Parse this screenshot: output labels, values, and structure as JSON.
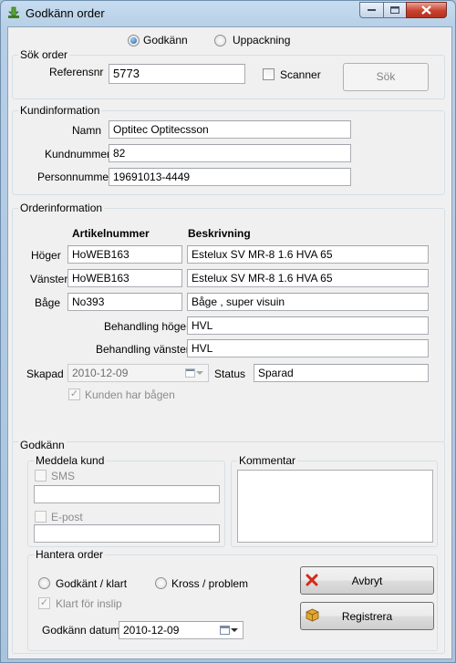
{
  "window": {
    "title": "Godkänn order",
    "icons": {
      "app": "download-arrow-icon",
      "minimize": "minimize-icon",
      "maximize": "maximize-icon",
      "close": "close-icon"
    }
  },
  "mode": {
    "option1": "Godkänn",
    "option2": "Uppackning",
    "selected": "Godkänn"
  },
  "sok_order": {
    "title": "Sök order",
    "referens_label": "Referensnr",
    "referens_value": "5773",
    "scanner_label": "Scanner",
    "search_button": "Sök"
  },
  "kundinformation": {
    "title": "Kundinformation",
    "namn_label": "Namn",
    "namn_value": "Optitec Optitecsson",
    "kundnummer_label": "Kundnummer",
    "kundnummer_value": "82",
    "personnummer_label": "Personnummer",
    "personnummer_value": "19691013-4449"
  },
  "orderinformation": {
    "title": "Orderinformation",
    "col_artikel": "Artikelnummer",
    "col_beskrivning": "Beskrivning",
    "rows": [
      {
        "label": "Höger",
        "artikel": "HoWEB163",
        "beskrivning": "Estelux SV MR-8 1.6 HVA 65"
      },
      {
        "label": "Vänster",
        "artikel": "HoWEB163",
        "beskrivning": "Estelux SV MR-8 1.6 HVA 65"
      },
      {
        "label": "Båge",
        "artikel": "No393",
        "beskrivning": "Båge , super visuin"
      }
    ],
    "behandling_hoger_label": "Behandling höger",
    "behandling_hoger_value": "HVL",
    "behandling_vanster_label": "Behandling vänster",
    "behandling_vanster_value": "HVL",
    "skapad_label": "Skapad",
    "skapad_value": "2010-12-09",
    "status_label": "Status",
    "status_value": "Sparad",
    "kunden_har_bagen_label": "Kunden har bågen",
    "kunden_har_bagen_checked": true
  },
  "godkann": {
    "title": "Godkänn",
    "meddela_kund": {
      "title": "Meddela kund",
      "sms_label": "SMS",
      "sms_value": "",
      "epost_label": "E-post",
      "epost_value": ""
    },
    "kommentar": {
      "title": "Kommentar",
      "value": ""
    }
  },
  "hantera_order": {
    "title": "Hantera order",
    "option_godkant": "Godkänt / klart",
    "option_kross": "Kross / problem",
    "klart_for_inslip_label": "Klart för inslip",
    "klart_for_inslip_checked": true,
    "godkann_datum_label": "Godkänn datum",
    "godkann_datum_value": "2010-12-09",
    "avbryt_button": "Avbryt",
    "registrera_button": "Registrera",
    "avbryt_icon": "red-x-icon",
    "registrera_icon": "package-icon"
  },
  "colors": {
    "window_frame": "#a9c3dc",
    "close_button": "#c8412d",
    "client_background": "#f0f0f0",
    "disabled_text": "#8b8b8b"
  }
}
